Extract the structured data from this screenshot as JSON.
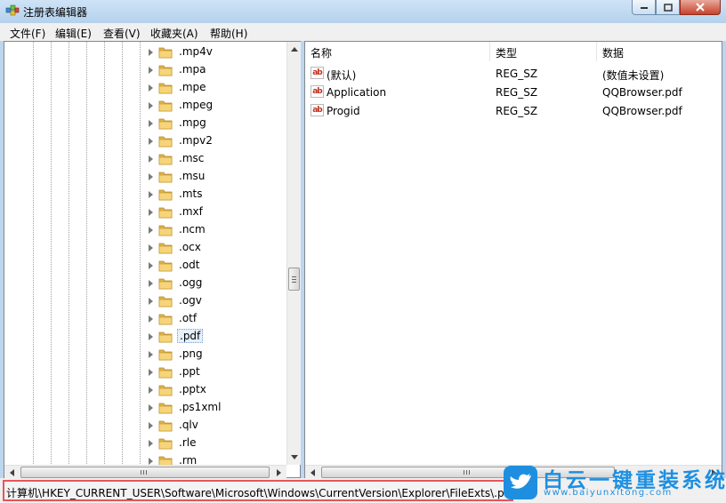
{
  "window": {
    "title": "注册表编辑器",
    "accent": "#bcd6ee"
  },
  "menu": {
    "items": [
      "文件(F)",
      "编辑(E)",
      "查看(V)",
      "收藏夹(A)",
      "帮助(H)"
    ]
  },
  "tree": {
    "items": [
      ".mp4v",
      ".mpa",
      ".mpe",
      ".mpeg",
      ".mpg",
      ".mpv2",
      ".msc",
      ".msu",
      ".mts",
      ".mxf",
      ".ncm",
      ".ocx",
      ".odt",
      ".ogg",
      ".ogv",
      ".otf",
      ".pdf",
      ".png",
      ".ppt",
      ".pptx",
      ".ps1xml",
      ".qlv",
      ".rle",
      ".rm"
    ],
    "selected": ".pdf"
  },
  "list": {
    "columns": [
      "名称",
      "类型",
      "数据"
    ],
    "rows": [
      {
        "name": "(默认)",
        "type": "REG_SZ",
        "data": "(数值未设置)",
        "icon": "string-value-icon"
      },
      {
        "name": "Application",
        "type": "REG_SZ",
        "data": "QQBrowser.pdf",
        "icon": "string-value-icon"
      },
      {
        "name": "Progid",
        "type": "REG_SZ",
        "data": "QQBrowser.pdf",
        "icon": "string-value-icon"
      }
    ]
  },
  "status": {
    "path": "计算机\\HKEY_CURRENT_USER\\Software\\Microsoft\\Windows\\CurrentVersion\\Explorer\\FileExts\\.pdf"
  },
  "watermark": {
    "title": "白云一键重装系统",
    "url": "www.baiyunxitong.com",
    "color": "#1e8fe0"
  },
  "colors": {
    "highlight_border": "#e8555a",
    "value_icon": "#c0301e",
    "folder": "#e8c15a"
  }
}
